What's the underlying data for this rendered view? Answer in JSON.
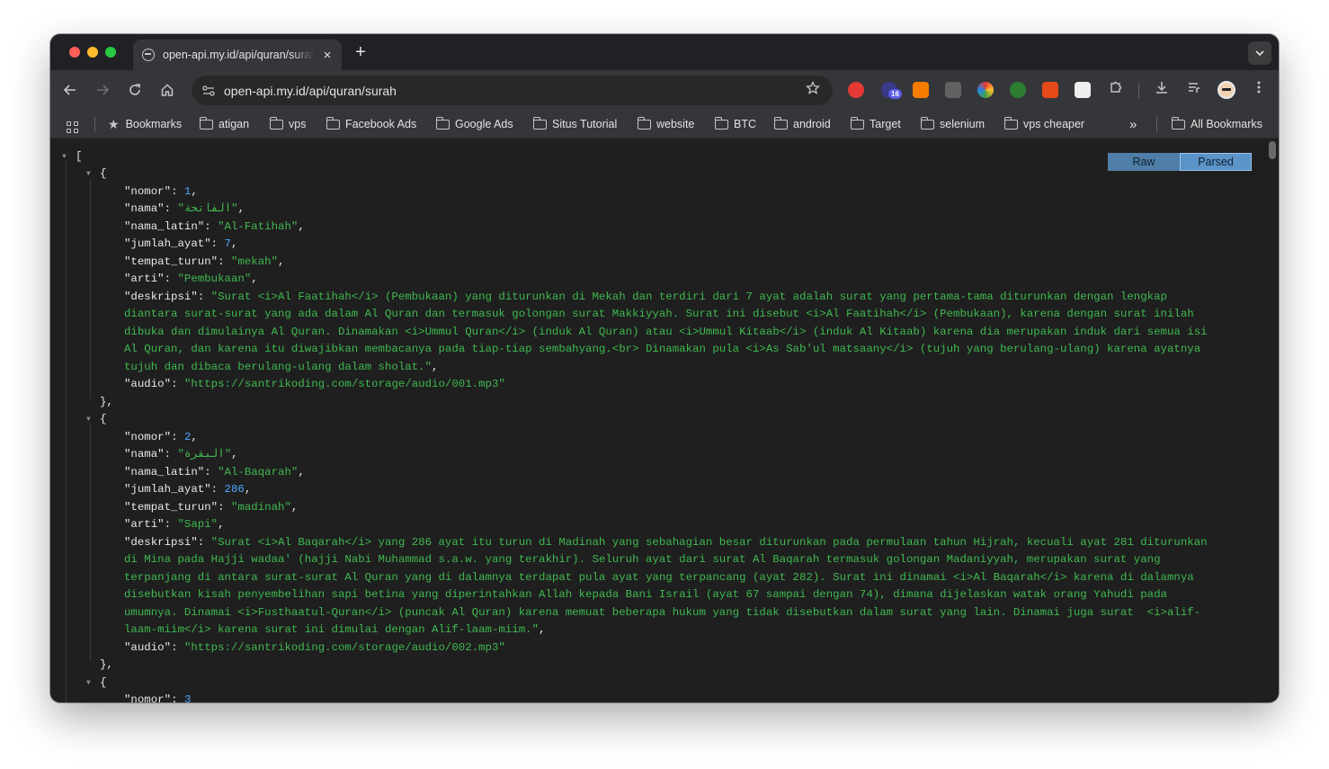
{
  "browser": {
    "tab_title": "open-api.my.id/api/quran/surah",
    "tab_close": "×",
    "new_tab": "+",
    "url": "open-api.my.id/api/quran/surah",
    "extension_badge": "16"
  },
  "bookmarks": {
    "items": [
      "Bookmarks",
      "atigan",
      "vps",
      "Facebook Ads",
      "Google Ads",
      "Situs Tutorial",
      "website",
      "BTC",
      "android",
      "Target",
      "selenium",
      "vps cheaper"
    ],
    "overflow": "»",
    "all": "All Bookmarks"
  },
  "viewer": {
    "raw_label": "Raw",
    "parsed_label": "Parsed"
  },
  "json": {
    "open_bracket": "[",
    "open_brace": "{",
    "close_brace_comma": "},",
    "surah": [
      {
        "nomor": "1",
        "nama": "\"الفاتحة\"",
        "nama_latin": "\"Al-Fatihah\"",
        "jumlah_ayat": "7",
        "tempat_turun": "\"mekah\"",
        "arti": "\"Pembukaan\"",
        "deskripsi_lines": [
          "\"Surat <i>Al Faatihah</i> (Pembukaan) yang diturunkan di Mekah dan terdiri dari 7 ayat adalah surat yang pertama-tama diturunkan dengan lengkap",
          "diantara surat-surat yang ada dalam Al Quran dan termasuk golongan surat Makkiyyah. Surat ini disebut <i>Al Faatihah</i> (Pembukaan), karena dengan surat inilah",
          "dibuka dan dimulainya Al Quran. Dinamakan <i>Ummul Quran</i> (induk Al Quran) atau <i>Ummul Kitaab</i> (induk Al Kitaab) karena dia merupakan induk dari semua isi",
          "Al Quran, dan karena itu diwajibkan membacanya pada tiap-tiap sembahyang.<br> Dinamakan pula <i>As Sab'ul matsaany</i> (tujuh yang berulang-ulang) karena ayatnya",
          "tujuh dan dibaca berulang-ulang dalam sholat.\""
        ],
        "audio": "\"https://santrikoding.com/storage/audio/001.mp3\""
      },
      {
        "nomor": "2",
        "nama": "\"البقرة\"",
        "nama_latin": "\"Al-Baqarah\"",
        "jumlah_ayat": "286",
        "tempat_turun": "\"madinah\"",
        "arti": "\"Sapi\"",
        "deskripsi_lines": [
          "\"Surat <i>Al Baqarah</i> yang 286 ayat itu turun di Madinah yang sebahagian besar diturunkan pada permulaan tahun Hijrah, kecuali ayat 281 diturunkan",
          "di Mina pada Hajji wadaa' (hajji Nabi Muhammad s.a.w. yang terakhir). Seluruh ayat dari surat Al Baqarah termasuk golongan Madaniyyah, merupakan surat yang",
          "terpanjang di antara surat-surat Al Quran yang di dalamnya terdapat pula ayat yang terpancang (ayat 282). Surat ini dinamai <i>Al Baqarah</i> karena di dalamnya",
          "disebutkan kisah penyembelihan sapi betina yang diperintahkan Allah kepada Bani Israil (ayat 67 sampai dengan 74), dimana dijelaskan watak orang Yahudi pada",
          "umumnya. Dinamai <i>Fusthaatul-Quran</i> (puncak Al Quran) karena memuat beberapa hukum yang tidak disebutkan dalam surat yang lain. Dinamai juga surat  <i>alif-",
          "laam-miim</i> karena surat ini dimulai dengan Alif-laam-miim.\""
        ],
        "audio": "\"https://santrikoding.com/storage/audio/002.mp3\""
      },
      {
        "nomor": "3"
      }
    ],
    "keys": {
      "nomor": "\"nomor\"",
      "nama": "\"nama\"",
      "nama_latin": "\"nama_latin\"",
      "jumlah_ayat": "\"jumlah_ayat\"",
      "tempat_turun": "\"tempat_turun\"",
      "arti": "\"arti\"",
      "deskripsi": "\"deskripsi\"",
      "audio": "\"audio\""
    }
  },
  "colors": {
    "window_bg": "#202124",
    "toolbar_bg": "#35363a",
    "content_bg": "#1f1f1f",
    "json_key": "#e8e8e8",
    "json_number": "#4ea6ff",
    "json_string": "#3fb950",
    "toggle_raw": "#4f7ea8",
    "toggle_parsed": "#5b94c8"
  },
  "icons": {
    "back": "back-arrow-icon",
    "forward": "forward-arrow-icon",
    "reload": "reload-icon",
    "home": "home-icon",
    "site_info": "site-info-icon",
    "bookmark_star": "star-icon",
    "downloads": "download-icon",
    "reading_list": "reading-list-icon",
    "menu": "kebab-menu-icon"
  }
}
